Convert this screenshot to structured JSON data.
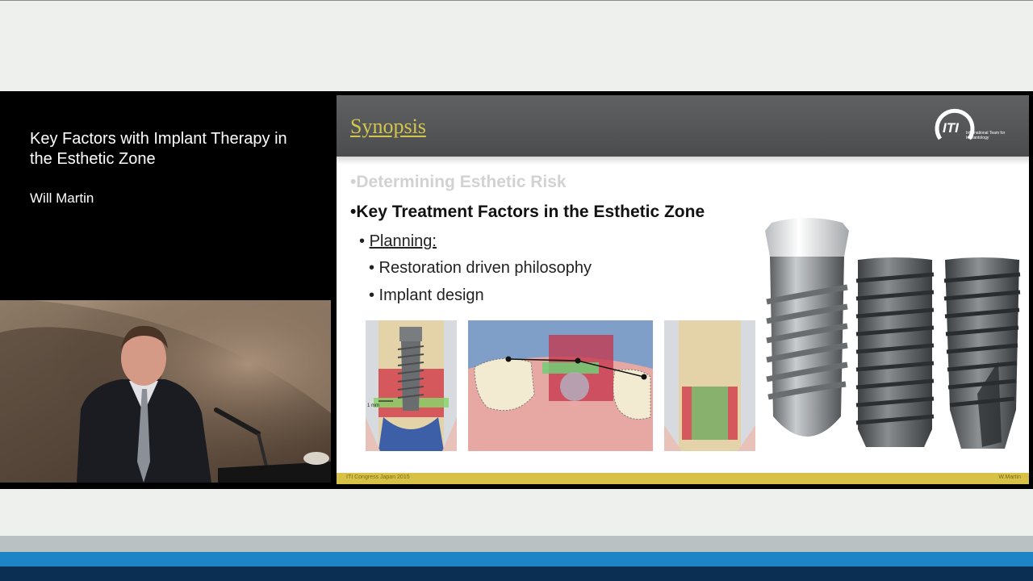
{
  "talk": {
    "title": "Key Factors with Implant Therapy in the Esthetic Zone",
    "speaker": "Will Martin"
  },
  "slide": {
    "title": "Synopsis",
    "logo": {
      "mark": "ITI",
      "text": "International Team for Implantology"
    },
    "bullets": {
      "faded": "•Determining Esthetic Risk",
      "main": "•Key Treatment Factors in the Esthetic Zone",
      "sub_prefix": "• ",
      "sub_label": "Planning:",
      "items": [
        "• Restoration driven philosophy",
        "• Implant design"
      ]
    },
    "illustration_labels": {
      "one_mm": "1 mm"
    },
    "footer": {
      "left": "ITI Congress Japan 2015",
      "right": "W.Martin"
    }
  },
  "colors": {
    "slide_header": "#55575a",
    "title_gold": "#d4c64a",
    "footer_gold": "#d7c247",
    "blue_stripe": "#1f84c6",
    "navy_stripe": "#0b2f52"
  }
}
